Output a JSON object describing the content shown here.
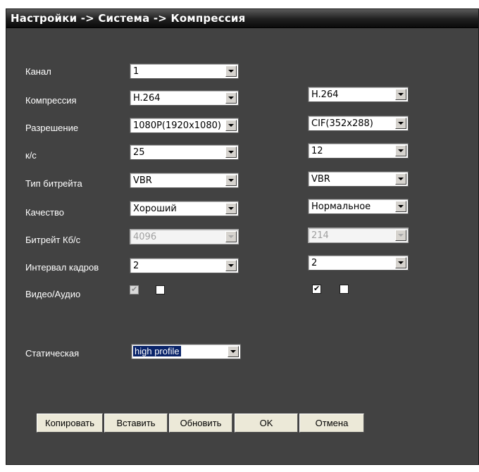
{
  "title": "Настройки -> Система -> Компрессия",
  "labels": {
    "channel": "Канал",
    "compression": "Компрессия",
    "resolution": "Разрешение",
    "fps": "к/с",
    "bitrate_type": "Тип битрейта",
    "quality": "Качество",
    "bitrate": "Битрейт Кб/с",
    "frame_interval": "Интервал кадров",
    "video_audio": "Видео/Аудио",
    "static": "Статическая"
  },
  "channel": "1",
  "main_stream": {
    "compression": "H.264",
    "resolution": "1080P(1920x1080)",
    "fps": "25",
    "bitrate_type": "VBR",
    "quality": "Хороший",
    "bitrate": "4096",
    "frame_interval": "2",
    "video_checked": true,
    "audio_checked": false
  },
  "extra_stream": {
    "compression": "H.264",
    "resolution": "CIF(352x288)",
    "fps": "12",
    "bitrate_type": "VBR",
    "quality": "Нормальное",
    "bitrate": "214",
    "frame_interval": "2",
    "video_checked": true,
    "audio_checked": false
  },
  "static_profile": "high profile",
  "buttons": {
    "copy": "Копировать",
    "paste": "Вставить",
    "refresh": "Обновить",
    "ok": "OK",
    "cancel": "Отмена"
  }
}
